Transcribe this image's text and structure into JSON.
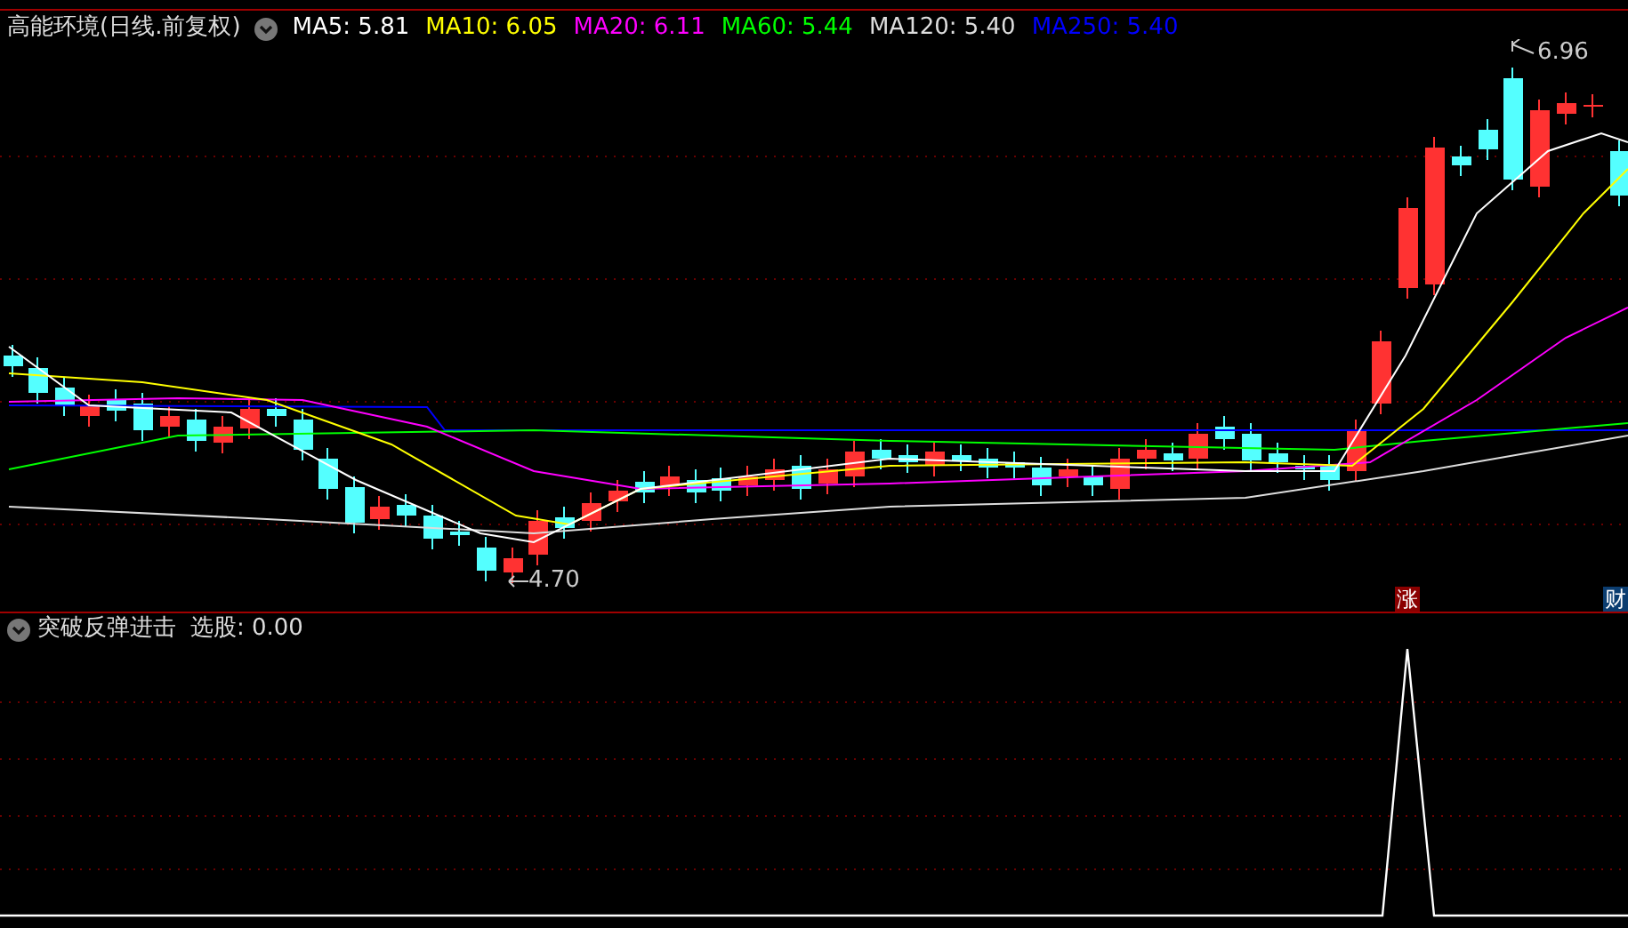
{
  "main_panel": {
    "title": "高能环境(日线.前复权)",
    "indicators": [
      {
        "label": "MA5: 5.81",
        "color": "#ffffff"
      },
      {
        "label": "MA10: 6.05",
        "color": "#ffff00"
      },
      {
        "label": "MA20: 6.11",
        "color": "#ff00ff"
      },
      {
        "label": "MA60: 5.44",
        "color": "#00ff00"
      },
      {
        "label": "MA120: 5.40",
        "color": "#dddddd"
      },
      {
        "label": "MA250: 5.40",
        "color": "#0000ff"
      }
    ],
    "high_label": "6.96",
    "low_label": "4.70",
    "badges": [
      {
        "text": "涨",
        "color": "#8b0000"
      },
      {
        "text": "财",
        "color": "#0b3d70"
      }
    ]
  },
  "sub_panel": {
    "title": "突破反弹进击",
    "reading": "选股: 0.00"
  }
}
